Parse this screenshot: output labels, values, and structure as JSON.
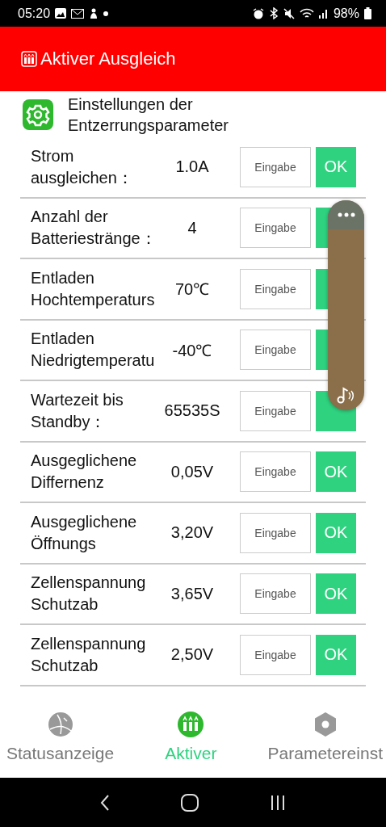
{
  "status_bar": {
    "time": "05:20",
    "battery": "98%"
  },
  "header": {
    "title": "Aktiver Ausgleich"
  },
  "section": {
    "title": "Einstellungen der Entzerrungsparameter"
  },
  "rows": [
    {
      "label": "Strom ausgleichen：",
      "value": "1.0A",
      "placeholder": "Eingabe",
      "button": "OK"
    },
    {
      "label": "Anzahl der Batteriestränge：",
      "value": "4",
      "placeholder": "Eingabe"
    },
    {
      "label": "Entladen Hochtemperaturs",
      "value": "70℃",
      "placeholder": "Eingabe"
    },
    {
      "label": "Entladen Niedrigtemperatu",
      "value": "-40℃",
      "placeholder": "Eingabe"
    },
    {
      "label": "Wartezeit bis Standby：",
      "value": "65535S",
      "placeholder": "Eingabe"
    },
    {
      "label": "Ausgeglichene Differnenz",
      "value": "0,05V",
      "placeholder": "Eingabe",
      "button": "OK"
    },
    {
      "label": "Ausgeglichene Öffnungs",
      "value": "3,20V",
      "placeholder": "Eingabe",
      "button": "OK"
    },
    {
      "label": "Zellenspannung Schutzab",
      "value": "3,65V",
      "placeholder": "Eingabe",
      "button": "OK"
    },
    {
      "label": "Zellenspannung Schutzab",
      "value": "2,50V",
      "placeholder": "Eingabe",
      "button": "OK"
    }
  ],
  "bottom_nav": [
    {
      "label": "Statusanzeige",
      "selected": false,
      "kind": "globe"
    },
    {
      "label": "Aktiver",
      "selected": true,
      "kind": "battery"
    },
    {
      "label": "Parametereinst",
      "selected": false,
      "kind": "hex"
    }
  ]
}
